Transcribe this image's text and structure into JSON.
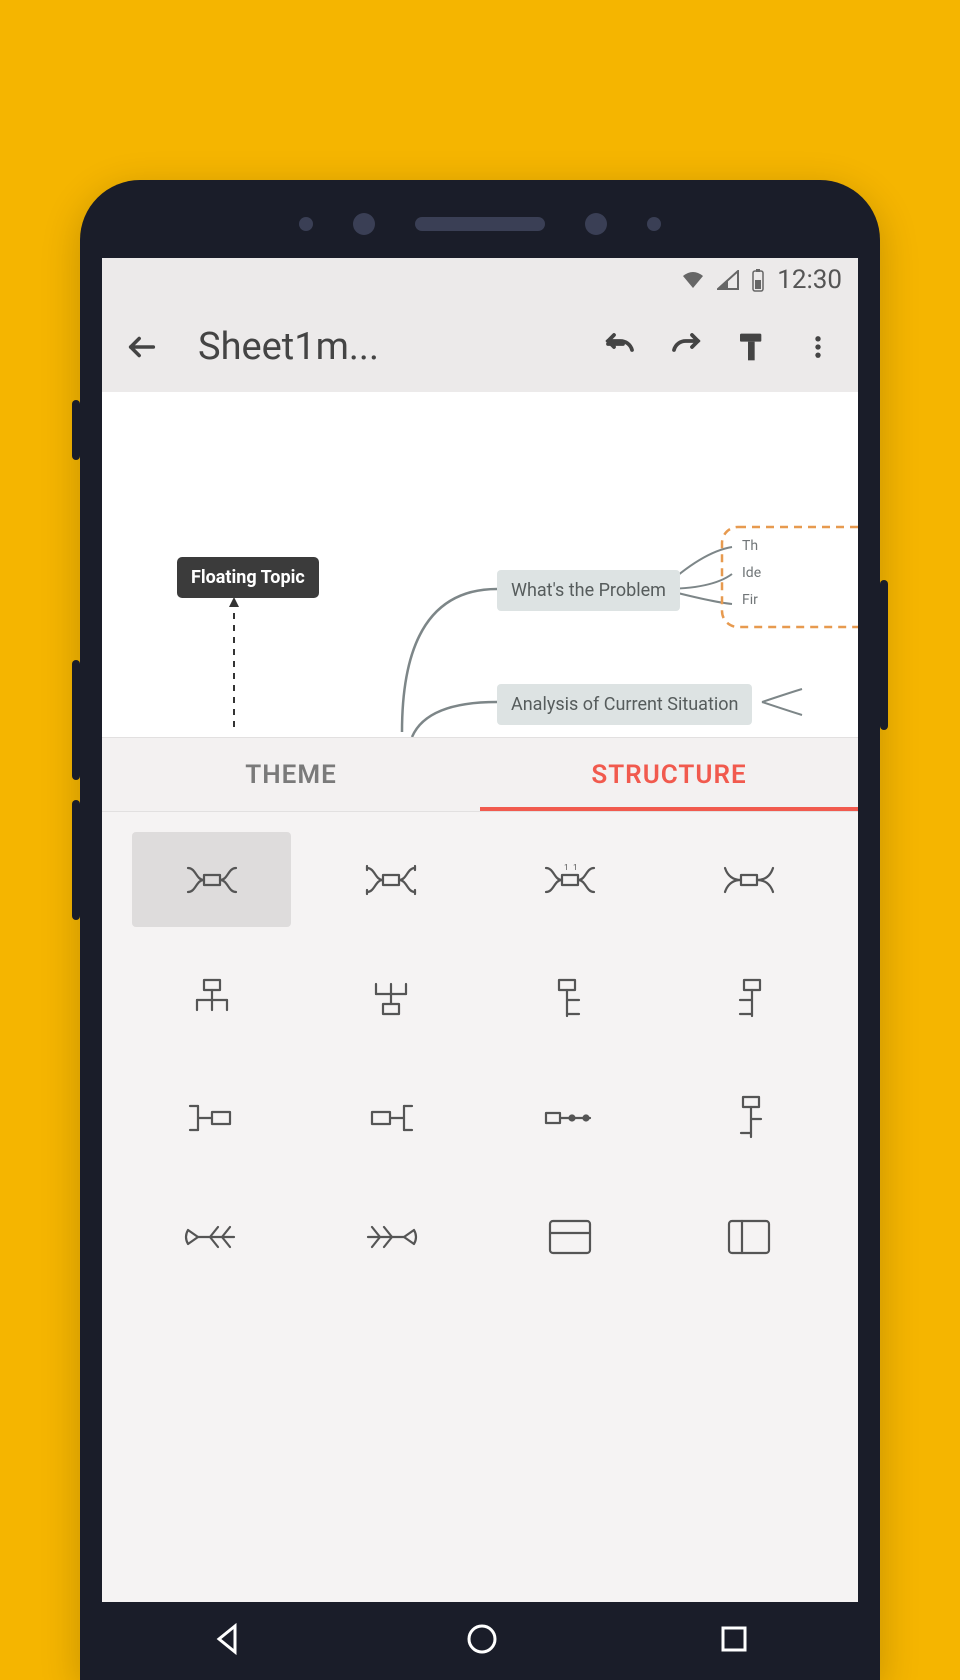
{
  "status": {
    "time": "12:30"
  },
  "toolbar": {
    "title": "Sheet1m..."
  },
  "canvas": {
    "floating_topic": "Floating Topic",
    "node1": "What's the Problem",
    "node2": "Analysis of Current Situation",
    "clip1": "Th",
    "clip2": "Ide",
    "clip3": "Fir"
  },
  "tabs": {
    "theme": "THEME",
    "structure": "STRUCTURE"
  },
  "structures": [
    {
      "name": "structure-h-spread",
      "selected": true
    },
    {
      "name": "structure-h-spread-down"
    },
    {
      "name": "structure-h-spread-num"
    },
    {
      "name": "structure-h-spread-smooth"
    },
    {
      "name": "structure-org-down"
    },
    {
      "name": "structure-org-up"
    },
    {
      "name": "structure-logic-right"
    },
    {
      "name": "structure-logic-left"
    },
    {
      "name": "structure-tree-right"
    },
    {
      "name": "structure-tree-left"
    },
    {
      "name": "structure-timeline"
    },
    {
      "name": "structure-timeline-vert"
    },
    {
      "name": "structure-fishbone-left"
    },
    {
      "name": "structure-fishbone-right"
    },
    {
      "name": "structure-matrix"
    },
    {
      "name": "structure-spreadsheet"
    }
  ]
}
